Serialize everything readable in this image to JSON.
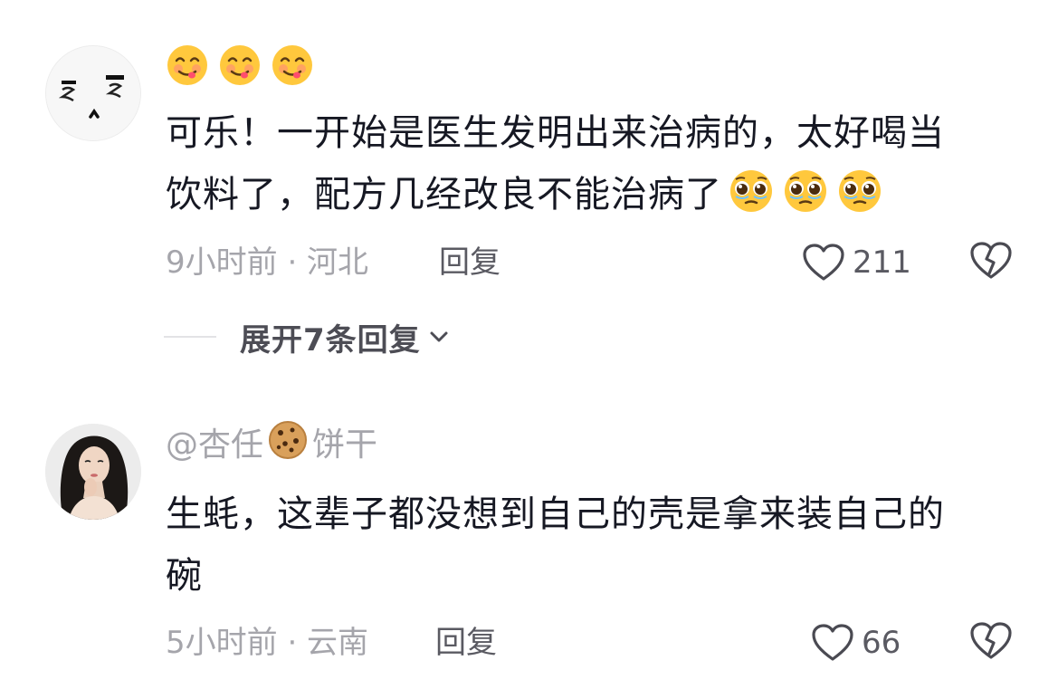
{
  "comments": [
    {
      "username": "",
      "text_line1": "可乐！一开始是医生发明出来治病的，太好喝当",
      "text_line2": "饮料了，配方几经改良不能治病了",
      "top_emojis": [
        "yum-emoji",
        "yum-emoji",
        "yum-emoji"
      ],
      "inline_emojis": [
        "pleading-emoji",
        "pleading-emoji",
        "pleading-emoji"
      ],
      "meta": "9小时前 · 河北",
      "reply_label": "回复",
      "likes": "211",
      "expand_label": "展开7条回复"
    },
    {
      "username_prefix": "@杏任",
      "username_emoji": "cookie-emoji",
      "username_suffix": "饼干",
      "text_line1": "生蚝，这辈子都没想到自己的壳是拿来装自己的",
      "text_line2": "碗",
      "meta": "5小时前 · 云南",
      "reply_label": "回复",
      "likes": "66"
    }
  ],
  "colors": {
    "text_primary": "#161823",
    "text_secondary": "#a5a5ab",
    "action_text": "#5a5a62",
    "yum_emoji": "#ffc83d",
    "pleading_emoji": "#ffc83d"
  }
}
